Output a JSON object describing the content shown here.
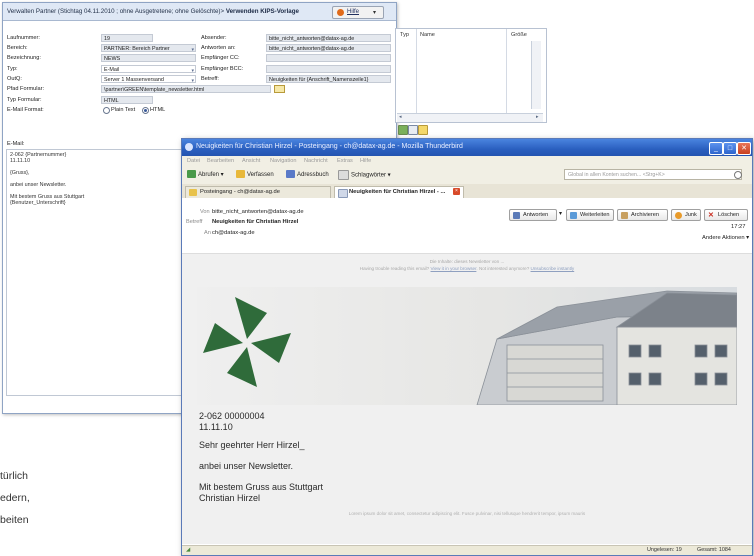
{
  "back_window": {
    "title_prefix": "Verwalten Partner (Stichtag 04.11.2010 ; ohne Ausgetretene; ohne Gelöschte)> ",
    "title_bold": "Verwenden KIPS-Vorlage",
    "help_label": "Hilfe",
    "fields": {
      "laufnummer_label": "Laufnummer:",
      "laufnummer": "19",
      "bereich_label": "Bereich:",
      "bereich": "PARTNER: Bereich Partner",
      "bezeichnung_label": "Bezeichnung:",
      "bezeichnung": "NEWS",
      "typ_label": "Typ:",
      "typ": "E-Mail",
      "outq_label": "OutQ:",
      "outq": "Server 1 Massenversand",
      "pfad_label": "Pfad Formular:",
      "pfad": "\\partner\\GREEN\\template_newsletter.html",
      "typ_formular_label": "Typ Formular:",
      "typ_formular": "HTML",
      "email_format_label": "E-Mail Format:",
      "plain_text": "Plain Text",
      "html": "HTML",
      "absender_label": "Absender:",
      "absender": "bitte_nicht_antworten@datax-ag.de",
      "antworten_label": "Antworten an:",
      "antworten": "bitte_nicht_antworten@datax-ag.de",
      "cc_label": "Empfänger CC:",
      "cc": "",
      "bcc_label": "Empfänger BCC:",
      "bcc": "",
      "betreff_label": "Betreff:",
      "betreff": "Neuigkeiten für {Anschrift_Namenszeile1}"
    },
    "attachments": {
      "col_typ": "Typ",
      "col_name": "Name",
      "col_size": "Größe"
    },
    "email_label": "E-Mail:",
    "email_lines": [
      "2-062 {Partnernummer}",
      "11.11.10",
      "",
      "{Gruss},",
      "",
      "anbei unser Newsletter.",
      "",
      "Mit bestem Gruss aus Stuttgart",
      "{Benutzer_Unterschrift}"
    ]
  },
  "thunderbird": {
    "title": "Neuigkeiten für Christian Hirzel - Posteingang - ch@datax-ag.de - Mozilla Thunderbird",
    "menu": [
      "Datei",
      "Bearbeiten",
      "Ansicht",
      "Navigation",
      "Nachricht",
      "Extras",
      "Hilfe"
    ],
    "toolbar": {
      "abrufen": "Abrufen",
      "verfassen": "Verfassen",
      "adressbuch": "Adressbuch",
      "schlagwoerter": "Schlagwörter"
    },
    "search_placeholder": "Global in allen Konten suchen... <Strg+K>",
    "tabs": [
      "Posteingang - ch@datax-ag.de",
      "Neuigkeiten für Christian Hirzel - ..."
    ],
    "header": {
      "von_label": "Von",
      "von": "bitte_nicht_antworten@datax-ag.de",
      "betreff_label": "Betreff",
      "betreff": "Neuigkeiten für Christian Hirzel",
      "an_label": "An",
      "an": "ch@datax-ag.de",
      "time": "17:27",
      "andere": "Andere Aktionen",
      "buttons": {
        "antworten": "Antworten",
        "weiterleiten": "Weiterleiten",
        "archivieren": "Archivieren",
        "junk": "Junk",
        "loeschen": "Löschen"
      }
    },
    "newsletter": {
      "notice1": "Die Inhalte: dieses Newsletter von ...",
      "notice2_pre": "Having trouble reading this email? ",
      "notice2_link": "View it in your browser",
      "notice2_mid": ". Not interested anymore? ",
      "notice2_link2": "Unsubscribe instantly",
      "lines": [
        "2-062 00000004",
        "11.11.10",
        "Sehr geehrter Herr Hirzel_",
        "anbei unser Newsletter.",
        "Mit bestem Gruss aus Stuttgart",
        "Christian Hirzel"
      ],
      "footer": "Lorem ipsum dolor sit amet, consectetur adipiscing elit. Fusce pulvinar, nisi tellusque hendrerit tempor, ipsum mauris"
    },
    "status": {
      "unread": "Ungelesen: 19",
      "total": "Gesamt: 1084"
    }
  },
  "edge_text": [
    "türlich",
    "edern,",
    "beiten"
  ],
  "colors": {
    "title_blue": "#2a5fbf",
    "logo_green": "#2f6b3a",
    "field_bg": "#e4e8ee"
  }
}
